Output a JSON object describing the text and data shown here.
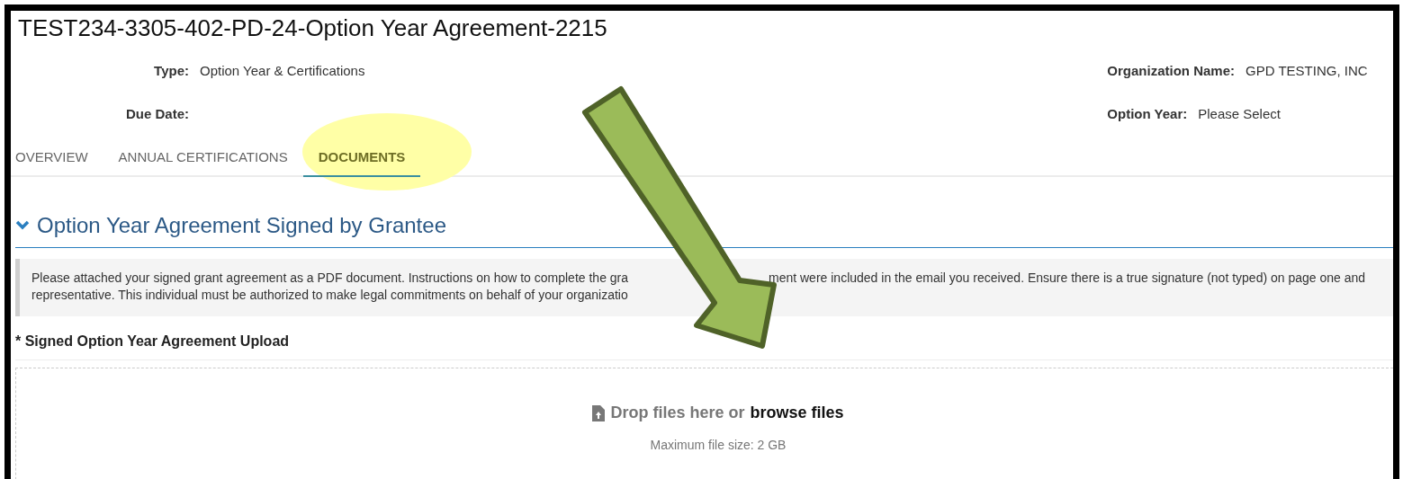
{
  "title": "TEST234-3305-402-PD-24-Option Year Agreement-2215",
  "fields_left": [
    {
      "label": "Type:",
      "value": "Option Year & Certifications"
    },
    {
      "label": "Due Date:"
    }
  ],
  "fields_right": [
    {
      "label": "Organization Name:",
      "value": "GPD TESTING, INC"
    },
    {
      "label": "Option Year:",
      "value": "Please Select"
    }
  ],
  "tabs": [
    {
      "label": "OVERVIEW",
      "selected": false
    },
    {
      "label": "ANNUAL CERTIFICATIONS",
      "selected": false
    },
    {
      "label": "DOCUMENTS",
      "selected": true
    }
  ],
  "section": {
    "title": "Option Year Agreement Signed by Grantee",
    "expanded": true,
    "instruction_lines": [
      [
        "Please attached your signed grant agreement as a PDF document. Instructions on how to complete the gra",
        "ment were included in the email you received. Ensure there is a true signature (not typed) on page one and"
      ],
      [
        "representative. This individual must be authorized to make legal commitments on behalf of your organizatio"
      ]
    ],
    "upload": {
      "label": "Signed Option Year Agreement Upload",
      "required_mark": "*",
      "drop_text": "Drop files here or",
      "browse_text": "browse files",
      "max_size": "Maximum file size: 2 GB"
    }
  }
}
